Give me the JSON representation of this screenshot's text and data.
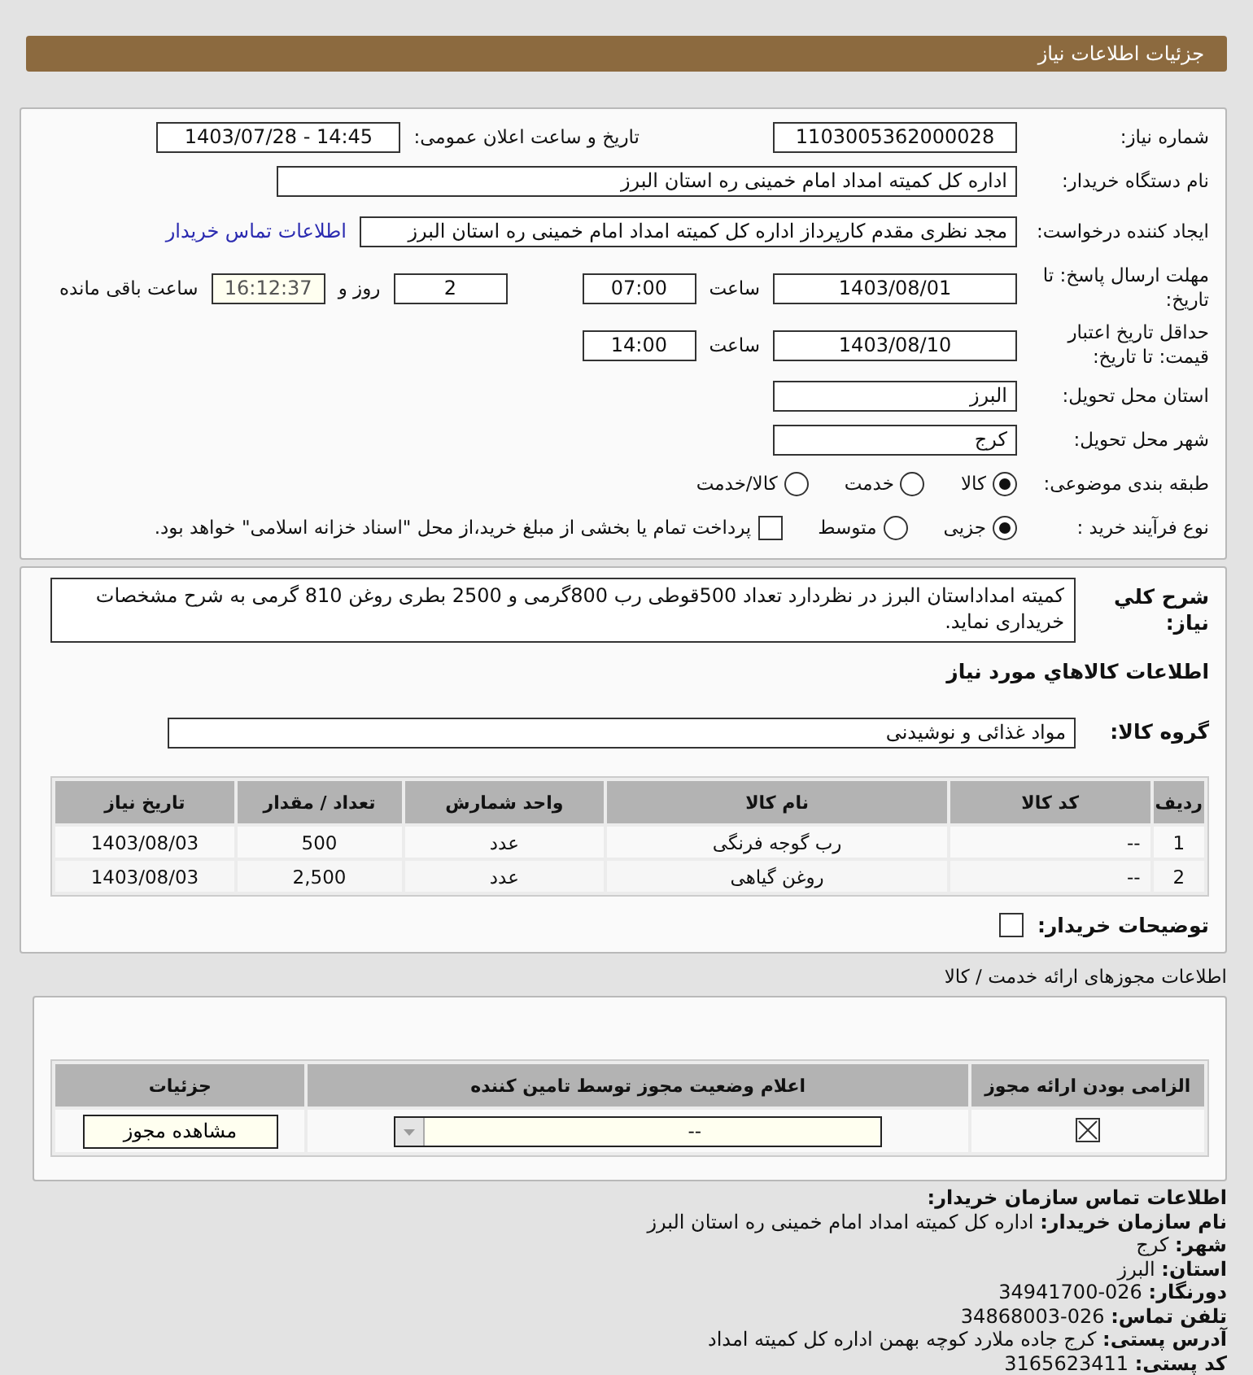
{
  "header": {
    "title": "جزئیات اطلاعات نیاز"
  },
  "need_number": {
    "label": "شماره نیاز:",
    "value": "1103005362000028"
  },
  "announce": {
    "label": "تاریخ و ساعت اعلان عمومی:",
    "value": "1403/07/28 - 14:45"
  },
  "buyer_name": {
    "label": "نام دستگاه خریدار:",
    "value": "اداره کل کمیته امداد امام خمینی  ره  استان البرز"
  },
  "requester": {
    "label": "ایجاد کننده درخواست:",
    "value": "مجد نظری مقدم کارپرداز اداره کل کمیته امداد امام خمینی  ره  استان البرز",
    "link": "اطلاعات تماس خریدار"
  },
  "reply_deadline": {
    "label": "مهلت ارسال پاسخ: تا تاریخ:",
    "date": "1403/08/01",
    "time_label": "ساعت",
    "time": "07:00",
    "days": "2",
    "days_label": "روز و",
    "remaining": "16:12:37",
    "remaining_label": "ساعت باقی مانده"
  },
  "price_validity": {
    "label": "حداقل تاریخ اعتبار قیمت: تا تاریخ:",
    "date": "1403/08/10",
    "time_label": "ساعت",
    "time": "14:00"
  },
  "province": {
    "label": "استان محل تحویل:",
    "value": "البرز"
  },
  "city": {
    "label": "شهر محل تحویل:",
    "value": "کرج"
  },
  "category": {
    "label": "طبقه بندی موضوعی:",
    "options": [
      {
        "label": "کالا",
        "selected": true
      },
      {
        "label": "خدمت",
        "selected": false
      },
      {
        "label": "کالا/خدمت",
        "selected": false
      }
    ]
  },
  "process": {
    "label": "نوع فرآیند خرید :",
    "options": [
      {
        "label": "جزیی",
        "selected": true
      },
      {
        "label": "متوسط",
        "selected": false
      }
    ],
    "payment": {
      "label": "پرداخت تمام یا بخشی از مبلغ خرید،از محل \"اسناد خزانه اسلامی\" خواهد بود.",
      "checked": false
    }
  },
  "description": {
    "label": "شرح کلي نیاز:",
    "text": "کمیته امداداستان البرز در نظردارد تعداد 500قوطی رب 800گرمی و 2500 بطری روغن 810 گرمی به شرح مشخصات خریداری نماید."
  },
  "goods_title": "اطلاعات کالاهاي مورد نیاز",
  "goods_group": {
    "label": "گروه کالا:",
    "value": "مواد غذائی و نوشیدنی"
  },
  "goods_table": {
    "columns": [
      "ردیف",
      "کد کالا",
      "نام کالا",
      "واحد شمارش",
      "تعداد / مقدار",
      "تاریخ نیاز"
    ],
    "rows": [
      [
        "1",
        "--",
        "رب گوجه فرنگی",
        "عدد",
        "500",
        "1403/08/03"
      ],
      [
        "2",
        "--",
        "روغن گیاهی",
        "عدد",
        "2,500",
        "1403/08/03"
      ]
    ]
  },
  "buyer_notes": {
    "label": "توضیحات خریدار:",
    "checked": false
  },
  "permits": {
    "title": "اطلاعات مجوزهای ارائه خدمت / کالا",
    "columns": [
      "الزامی بودن ارائه مجوز",
      "اعلام وضعیت مجوز توسط تامین کننده",
      "جزئیات"
    ],
    "rows": [
      {
        "required": true,
        "status": "--",
        "button": "مشاهده مجوز"
      }
    ]
  },
  "contact": {
    "title": "اطلاعات تماس سازمان خریدار:",
    "lines": [
      {
        "label": "نام سازمان خریدار:",
        "value": "اداره کل کمیته امداد امام خمینی ره استان البرز"
      },
      {
        "label": "شهر:",
        "value": "کرج"
      },
      {
        "label": "استان:",
        "value": "البرز"
      },
      {
        "label": "دورنگار:",
        "value": "34941700-026"
      },
      {
        "label": "تلفن تماس:",
        "value": "34868003-026"
      },
      {
        "label": "آدرس پستی:",
        "value": "کرج جاده ملارد کوچه بهمن اداره کل کمیته امداد"
      },
      {
        "label": "کد پستی:",
        "value": "3165623411"
      }
    ]
  }
}
